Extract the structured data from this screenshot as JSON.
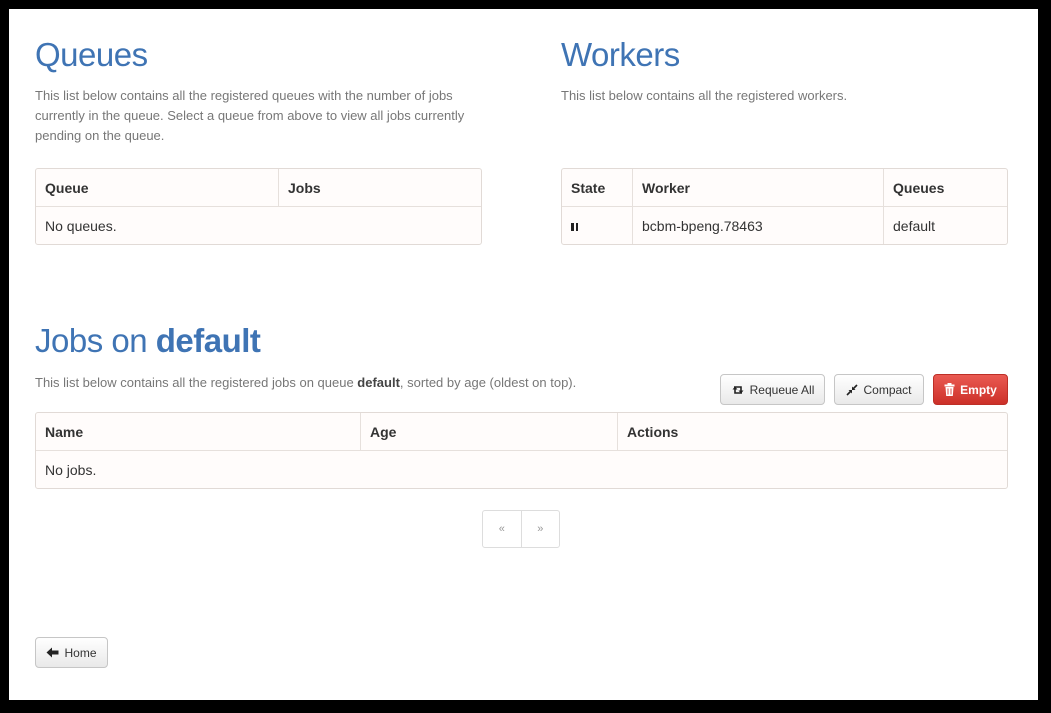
{
  "queues": {
    "title": "Queues",
    "description": "This list below contains all the registered queues with the number of jobs currently in the queue. Select a queue from above to view all jobs currently pending on the queue.",
    "columns": [
      "Queue",
      "Jobs"
    ],
    "empty_text": "No queues."
  },
  "workers": {
    "title": "Workers",
    "description": "This list below contains all the registered workers.",
    "columns": [
      "State",
      "Worker",
      "Queues"
    ],
    "rows": [
      {
        "state_icon": "pause-icon",
        "worker": "bcbm-bpeng.78463",
        "queues": "default"
      }
    ]
  },
  "jobs": {
    "title_prefix": "Jobs on ",
    "queue_name": "default",
    "description_prefix": "This list below contains all the registered jobs on queue ",
    "description_queue": "default",
    "description_suffix": ", sorted by age (oldest on top).",
    "columns": [
      "Name",
      "Age",
      "Actions"
    ],
    "empty_text": "No jobs.",
    "buttons": {
      "requeue_all": "Requeue All",
      "compact": "Compact",
      "empty": "Empty"
    },
    "pagination": {
      "prev": "«",
      "next": "»"
    }
  },
  "footer": {
    "home_label": "Home"
  },
  "colors": {
    "heading": "#3f74b4",
    "danger": "#d9403a",
    "table_bg": "#fffcfb"
  }
}
